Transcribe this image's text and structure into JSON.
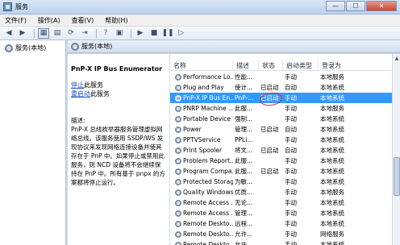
{
  "window": {
    "title": "服务",
    "buttons": [
      "—",
      "☐",
      "✕"
    ]
  },
  "menu": [
    "文件(F)",
    "操作(A)",
    "查看(V)",
    "帮助(H)"
  ],
  "toolbar": {
    "icons": [
      "back-icon",
      "forward-icon",
      "console-tree-icon",
      "properties-icon",
      "refresh-icon",
      "export-icon",
      "help-icon",
      "play-icon",
      "stop-icon",
      "pause-icon",
      "restart-icon"
    ]
  },
  "left_pane": {
    "tree_item": "服务(本地)"
  },
  "right_header": {
    "label": "服务(本地)"
  },
  "description": {
    "title": "PnP-X IP Bus Enumerator",
    "stop_link": "停止",
    "stop_suffix": "此服务",
    "restart_link": "重启动",
    "restart_suffix": "此服务",
    "label": "描述:",
    "body": "PnP-X 总线枚举器服务管理虚拟网络总线。该服务使用 SSDP/WS 发现协议来发现网络连接设备并使其存在于 PnP 中。如果停止或禁用此服务，则 NCD 设备将不会继续保持在 PnP 中。所有基于 pnpx 的方案都将停止运行。"
  },
  "list": {
    "columns": [
      "名称",
      "描述",
      "状态",
      "启动类型",
      "登录为"
    ],
    "rows": [
      {
        "name": "Performance Lo...",
        "desc": "性能...",
        "status": "",
        "start": "手动",
        "logon": "本地服务",
        "selected": false
      },
      {
        "name": "Plug and Play",
        "desc": "使计...",
        "status": "已启动",
        "start": "自动",
        "logon": "本地系统",
        "selected": false
      },
      {
        "name": "PnP-X IP Bus En...",
        "desc": "PnP-...",
        "status": "已启动",
        "start": "手动",
        "logon": "本地系统",
        "selected": true
      },
      {
        "name": "PNRP Machine ...",
        "desc": "此服...",
        "status": "",
        "start": "手动",
        "logon": "本地服务",
        "selected": false
      },
      {
        "name": "Portable Device ...",
        "desc": "强制...",
        "status": "",
        "start": "手动",
        "logon": "本地系统",
        "selected": false
      },
      {
        "name": "Power",
        "desc": "管理...",
        "status": "已启动",
        "start": "自动",
        "logon": "本地系统",
        "selected": false
      },
      {
        "name": "PPTVService",
        "desc": "PPLi...",
        "status": "",
        "start": "手动",
        "logon": "本地系统",
        "selected": false
      },
      {
        "name": "Print Spooler",
        "desc": "将文...",
        "status": "已启动",
        "start": "自动",
        "logon": "本地系统",
        "selected": false
      },
      {
        "name": "Problem Report...",
        "desc": "此服...",
        "status": "",
        "start": "手动",
        "logon": "本地系统",
        "selected": false
      },
      {
        "name": "Program Compa...",
        "desc": "此服...",
        "status": "已启动",
        "start": "手动",
        "logon": "本地系统",
        "selected": false
      },
      {
        "name": "Protected Storage",
        "desc": "为敏...",
        "status": "",
        "start": "手动",
        "logon": "本地系统",
        "selected": false
      },
      {
        "name": "Quality Windows...",
        "desc": "优质...",
        "status": "",
        "start": "手动",
        "logon": "本地服务",
        "selected": false
      },
      {
        "name": "Remote Access ...",
        "desc": "无论...",
        "status": "",
        "start": "手动",
        "logon": "本地系统",
        "selected": false
      },
      {
        "name": "Remote Access ...",
        "desc": "管理...",
        "status": "",
        "start": "手动",
        "logon": "本地系统",
        "selected": false
      },
      {
        "name": "Remote Deskto...",
        "desc": "远程...",
        "status": "",
        "start": "手动",
        "logon": "本地系统",
        "selected": false
      },
      {
        "name": "Remote Deskto...",
        "desc": "允许...",
        "status": "",
        "start": "手动",
        "logon": "网络服务",
        "selected": false
      },
      {
        "name": "Remote Deskto...",
        "desc": "允许...",
        "status": "",
        "start": "手动",
        "logon": "本地系统",
        "selected": false
      }
    ]
  },
  "annotation": {
    "color": "#d33333"
  }
}
